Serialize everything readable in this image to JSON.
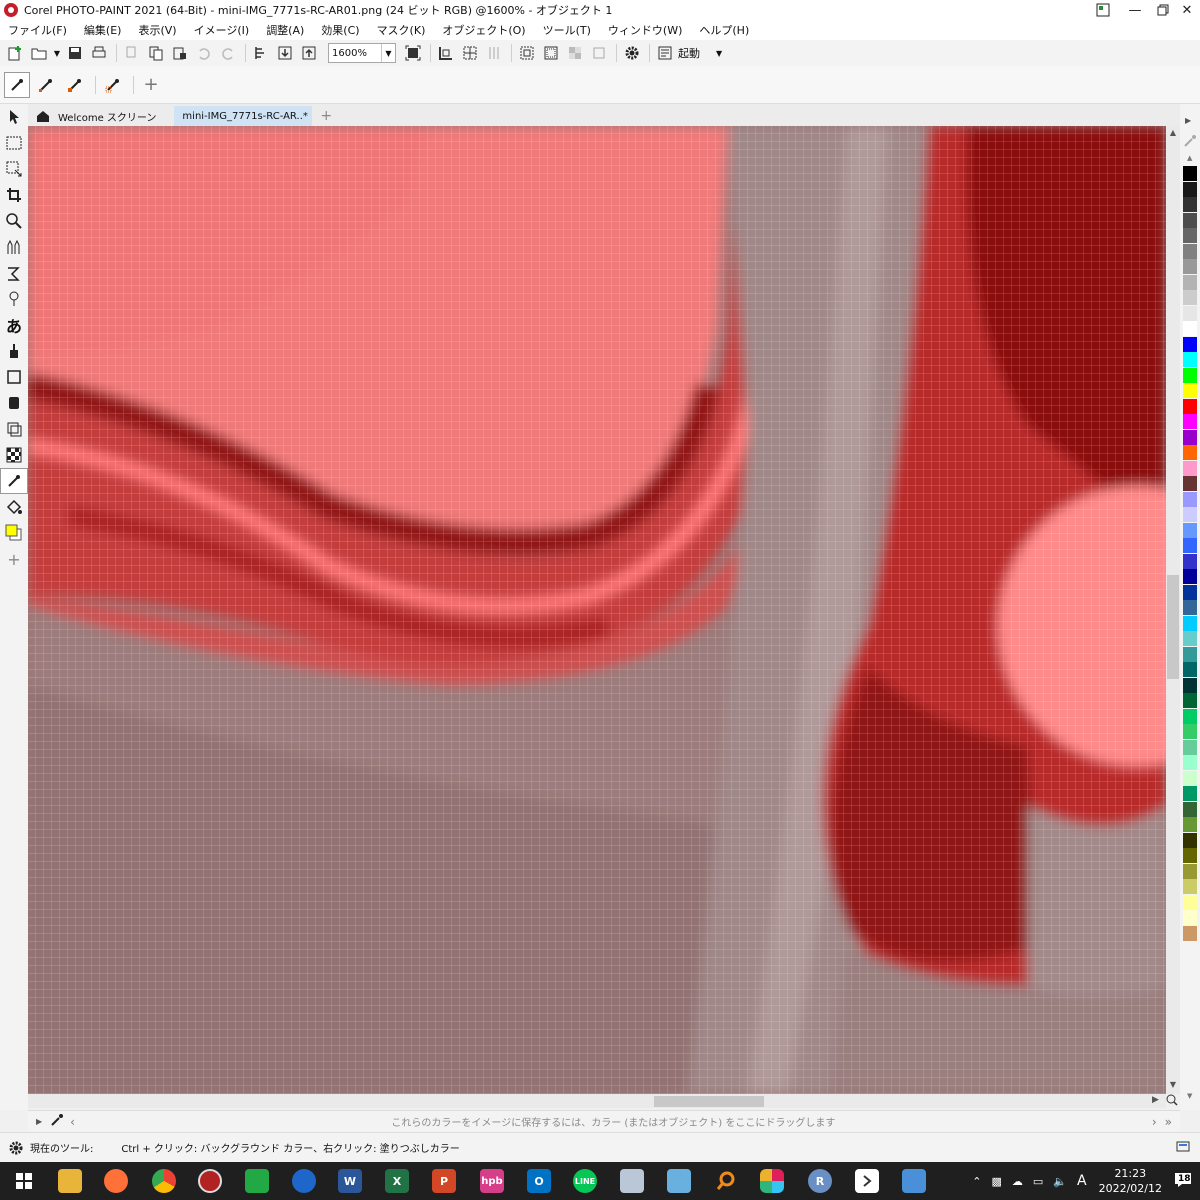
{
  "window": {
    "title": "Corel PHOTO-PAINT 2021 (64-Bit) - mini-IMG_7771s-RC-AR01.png (24 ビット RGB) @1600% - オブジェクト 1"
  },
  "menu": [
    "ファイル(F)",
    "編集(E)",
    "表示(V)",
    "イメージ(I)",
    "調整(A)",
    "効果(C)",
    "マスク(K)",
    "オブジェクト(O)",
    "ツール(T)",
    "ウィンドウ(W)",
    "ヘルプ(H)"
  ],
  "toolbar": {
    "zoom_value": "1600%",
    "launch_label": "起動"
  },
  "tabs": [
    {
      "label": "Welcome スクリーン",
      "active": false
    },
    {
      "label": "mini-IMG_7771s-RC-AR..*",
      "active": true
    }
  ],
  "canvas": {
    "zoom_percent": 1600
  },
  "palette_colors": [
    "#000000",
    "#1a1a1a",
    "#333333",
    "#4d4d4d",
    "#666666",
    "#808080",
    "#999999",
    "#b3b3b3",
    "#cccccc",
    "#e6e6e6",
    "#ffffff",
    "#0000ff",
    "#00ffff",
    "#00ff00",
    "#ffff00",
    "#ff0000",
    "#ff00ff",
    "#9900cc",
    "#ff6600",
    "#ff99cc",
    "#663333",
    "#9999ff",
    "#ccccff",
    "#6699ff",
    "#3366ff",
    "#3333cc",
    "#000099",
    "#003399",
    "#336699",
    "#00ccff",
    "#66cccc",
    "#339999",
    "#006666",
    "#003333",
    "#006633",
    "#00cc66",
    "#33cc66",
    "#66cc99",
    "#99ffcc",
    "#ccffcc",
    "#009966",
    "#336633",
    "#669933",
    "#333300",
    "#666600",
    "#999933",
    "#cccc66",
    "#ffff99",
    "#ffffcc",
    "#cc9966"
  ],
  "hint": "これらのカラーをイメージに保存するには、カラー (またはオブジェクト) をここにドラッグします",
  "status": {
    "current_tool_label": "現在のツール:",
    "tip": "Ctrl + クリック: バックグラウンド カラー、右クリック: 塗りつぶしカラー"
  },
  "taskbar": {
    "time": "21:23",
    "date": "2022/02/12",
    "notification_count": "18",
    "ime": "A"
  }
}
